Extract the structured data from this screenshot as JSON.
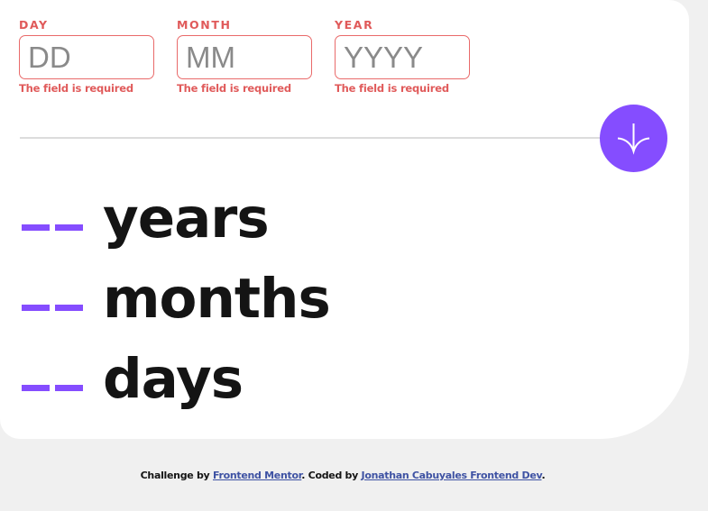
{
  "form": {
    "day": {
      "label": "DAY",
      "placeholder": "DD",
      "value": "",
      "error": "The field is required"
    },
    "month": {
      "label": "MONTH",
      "placeholder": "MM",
      "value": "",
      "error": "The field is required"
    },
    "year": {
      "label": "YEAR",
      "placeholder": "YYYY",
      "value": "",
      "error": "The field is required"
    },
    "submit_icon": "arrow-down-icon"
  },
  "results": {
    "years": {
      "value": "- -",
      "label": "years"
    },
    "months": {
      "value": "- -",
      "label": "months"
    },
    "days": {
      "value": "- -",
      "label": "days"
    }
  },
  "footer": {
    "prefix": "Challenge by ",
    "challenge_link": "Frontend Mentor",
    "middle": ". Coded by ",
    "author_link": "Jonathan Cabuyales Frontend Dev",
    "suffix": "."
  },
  "colors": {
    "accent": "#854dff",
    "error": "#e05a5a",
    "background": "#f0f0f0",
    "card": "#ffffff"
  }
}
